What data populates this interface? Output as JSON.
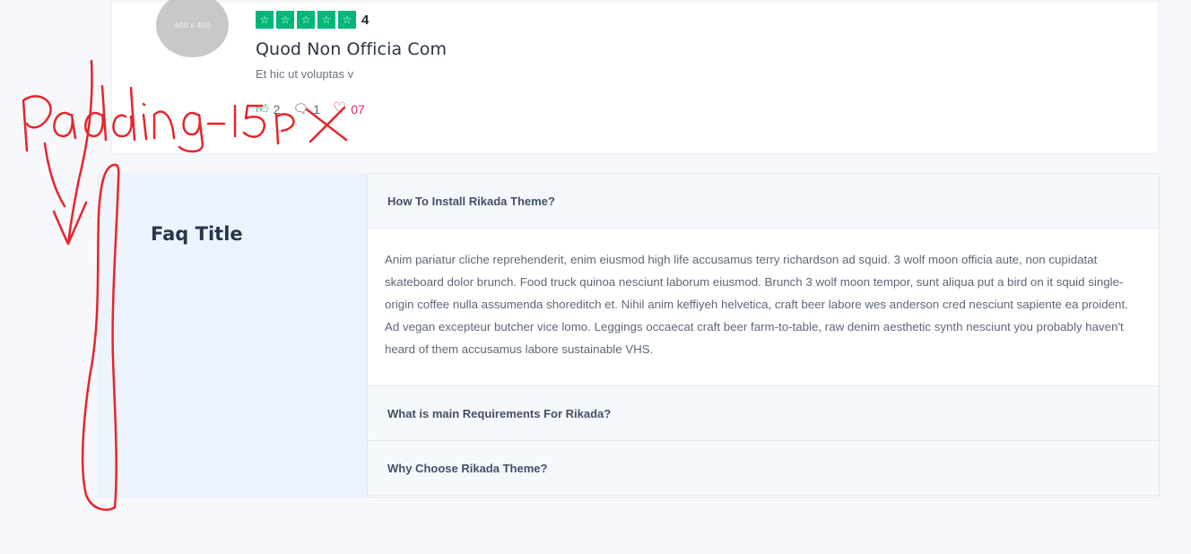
{
  "review": {
    "avatar_placeholder": "400 x 400",
    "stars": [
      "☆",
      "☆",
      "☆",
      "☆",
      "☆"
    ],
    "rating": "4",
    "title": "Quod Non Officia Com",
    "text": "Et hic ut voluptas v",
    "likes": "2",
    "comments": "1",
    "hearts": "07",
    "star_color": "#00b67a",
    "heart_color": "#e0245e"
  },
  "faq": {
    "title": "Faq Title",
    "items": [
      {
        "question": "How To Install Rikada Theme?"
      },
      {
        "answer": "Anim pariatur cliche reprehenderit, enim eiusmod high life accusamus terry richardson ad squid. 3 wolf moon officia aute, non cupidatat skateboard dolor brunch. Food truck quinoa nesciunt laborum eiusmod. Brunch 3 wolf moon tempor, sunt aliqua put a bird on it squid single-origin coffee nulla assumenda shoreditch et. Nihil anim keffiyeh helvetica, craft beer labore wes anderson cred nesciunt sapiente ea proident. Ad vegan excepteur butcher vice lomo. Leggings occaecat craft beer farm-to-table, raw denim aesthetic synth nesciunt you probably haven't heard of them accusamus labore sustainable VHS."
      },
      {
        "question": "What is main Requirements For Rikada?"
      },
      {
        "question": "Why Choose Rikada Theme?"
      }
    ]
  },
  "annotation": {
    "handwritten_text": "padding-15px",
    "color": "#e8242a"
  }
}
